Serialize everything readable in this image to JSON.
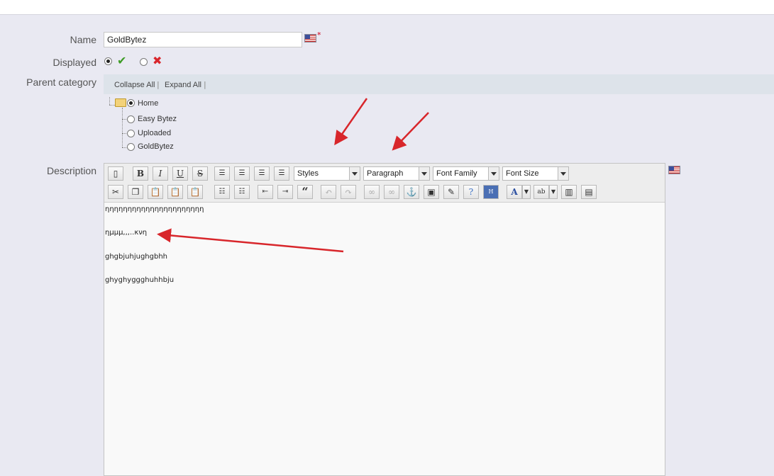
{
  "form": {
    "name_label": "Name",
    "name_value": "GoldBytez",
    "required_mark": "*",
    "displayed_label": "Displayed",
    "parent_label": "Parent category",
    "description_label": "Description",
    "displayed_yes_icon": "check-icon",
    "displayed_no_icon": "cross-icon"
  },
  "category_tree": {
    "collapse_all": "Collapse All",
    "expand_all": "Expand All",
    "separator": "|",
    "root": "Home",
    "children": [
      "Easy Bytez",
      "Uploaded",
      "GoldBytez"
    ]
  },
  "editor": {
    "styles": "Styles",
    "format": "Paragraph",
    "font_family": "Font Family",
    "font_size": "Font Size",
    "lines": [
      "ηηηηηηηηηηηηηηηηηηηηηη",
      "ημμμ,,,..κνη",
      "ghgbjuhjughgbhh",
      "ghyghyggghuhhbju"
    ]
  },
  "colors": {
    "annotation_arrows": "#d8262b",
    "accent_check": "#3d9c26",
    "accent_cross": "#d9262c"
  }
}
